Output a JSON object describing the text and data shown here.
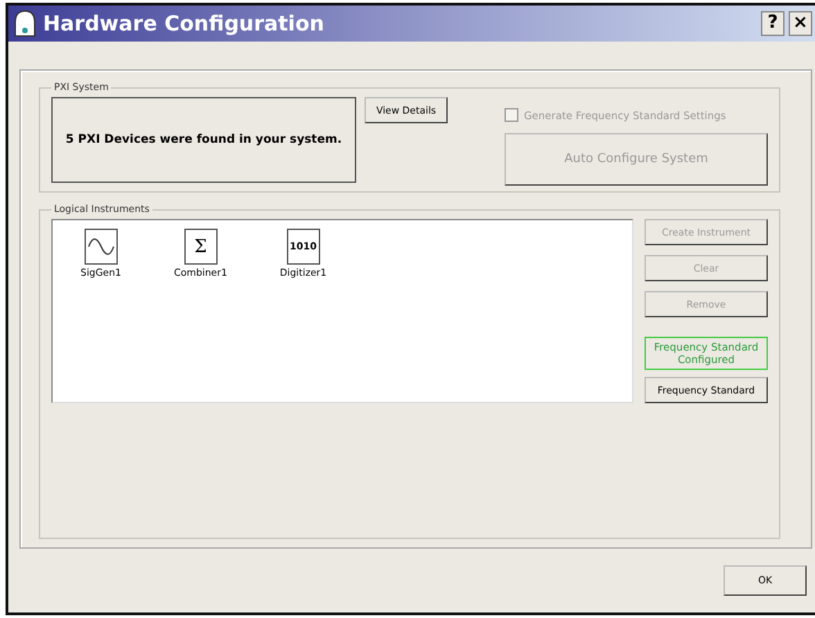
{
  "window": {
    "title": "Hardware Configuration",
    "help_button": "?",
    "close_button": "×"
  },
  "pxi_system": {
    "label": "PXI System",
    "message": "5 PXI Devices were found in your system.",
    "view_details": {
      "label": "View Details",
      "disabled": false
    },
    "generate_checkbox": {
      "label": "Generate Frequency Standard Settings",
      "checked": false,
      "disabled": true
    },
    "auto_configure": {
      "label": "Auto Configure System",
      "disabled": true
    }
  },
  "logical_instruments": {
    "label": "Logical Instruments",
    "items": [
      {
        "name": "SigGen1",
        "kind": "wave"
      },
      {
        "name": "Combiner1",
        "kind": "glyph",
        "glyph": "Σ"
      },
      {
        "name": "Digitizer1",
        "kind": "glyph",
        "glyph": "1010"
      }
    ],
    "buttons": [
      {
        "label": "Create Instrument",
        "disabled": true
      },
      {
        "label": "Clear",
        "disabled": true
      },
      {
        "label": "Remove",
        "disabled": true
      }
    ],
    "status": "Frequency Standard Configured",
    "frequency_button": {
      "label": "Frequency Standard",
      "disabled": false
    }
  },
  "ok_button": "OK"
}
